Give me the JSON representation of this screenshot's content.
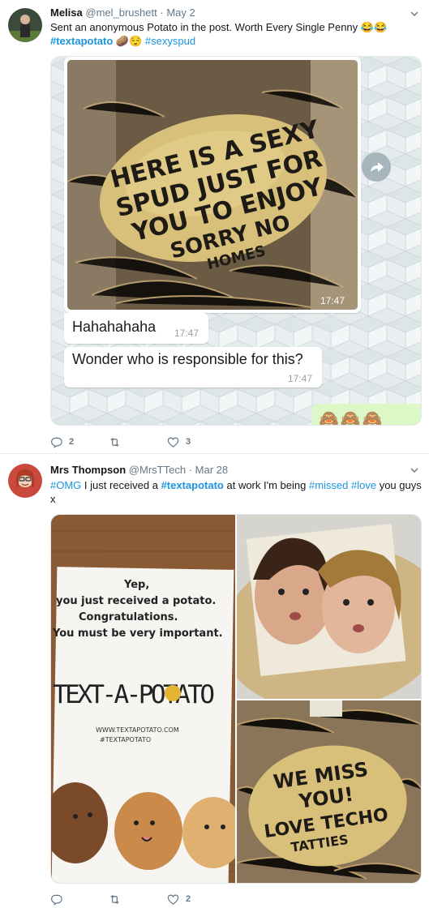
{
  "tweets": [
    {
      "name": "Melisa",
      "handle": "@mel_brushett",
      "dot": "·",
      "date": "May 2",
      "text_plain": "Sent an anonymous Potato in the post. Worth Every Single Penny 😂😂",
      "tags_line": [
        "#textapotato",
        "🥔😌",
        "#sexyspud"
      ],
      "media": {
        "potato_text": [
          "HERE IS A SEXY",
          "SPUD JUST FOR",
          "YOU TO ENJOY",
          "SORRY NO",
          "HOMES"
        ],
        "photo_time": "17:47",
        "msg1": "Hahahahaha",
        "msg1_time": "17:47",
        "msg2": "Wonder who is responsible for this?",
        "msg2_time": "17:47",
        "emoji_row": "🙈🙈🙈"
      },
      "replies": "2",
      "retweets": "",
      "likes": "3"
    },
    {
      "name": "Mrs Thompson",
      "handle": "@MrsTTech",
      "dot": "·",
      "date": "Mar 28",
      "text_parts": [
        "#OMG",
        " I just received a ",
        "#textapotato",
        " at work I'm being ",
        "#missed",
        " ",
        "#love",
        " you guys x"
      ],
      "media": {
        "card_lines": [
          "Yep,",
          "you just received a potato.",
          "Congratulations.",
          "You must be very important."
        ],
        "card_brand": "TEXT-A-POTATO",
        "card_url": "WWW.TEXTAPOTATO.COM",
        "card_tag": "#TEXTAPOTATO",
        "potato2_text": [
          "WE MISS",
          "YOU!",
          "LOVE TECHO",
          "TATTIES"
        ]
      },
      "replies": "",
      "retweets": "",
      "likes": "2"
    }
  ],
  "colors": {
    "link": "#1b95e0",
    "muted": "#657786",
    "text": "#14171a",
    "border": "#e6ecf0"
  }
}
